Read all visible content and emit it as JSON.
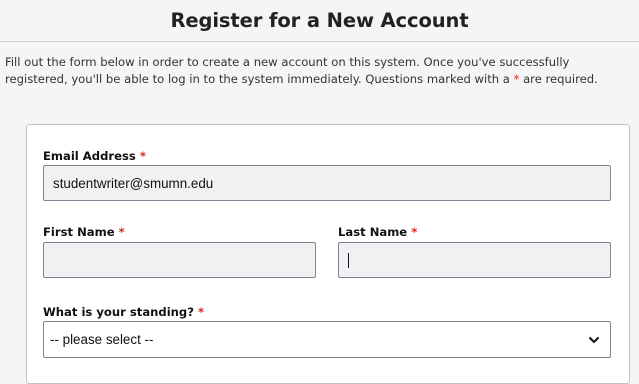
{
  "page": {
    "title": "Register for a New Account",
    "intro_text": "Fill out the form below in order to create a new account on this system. Once you've successfully registered, you'll be able to log in to the system immediately. Questions marked with a ",
    "intro_required_marker": "*",
    "intro_text_end": " are required."
  },
  "form": {
    "required_marker": "*",
    "email": {
      "label": "Email Address",
      "value": "studentwriter@smumn.edu"
    },
    "first_name": {
      "label": "First Name",
      "value": ""
    },
    "last_name": {
      "label": "Last Name",
      "value": ""
    },
    "standing": {
      "label": "What is your standing?",
      "selected": "-- please select --"
    }
  },
  "icons": {
    "select_arrow": "chevron-down-icon"
  },
  "colors": {
    "required": "#d8261c",
    "field_border": "#7f8392",
    "field_bg": "#f1f1f4"
  }
}
